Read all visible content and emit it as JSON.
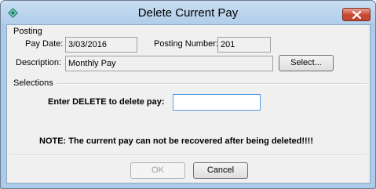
{
  "window": {
    "title": "Delete Current Pay",
    "icon": "app-diamond-icon",
    "close_icon": "close-icon"
  },
  "posting": {
    "group_label": "Posting",
    "pay_date_label": "Pay Date:",
    "pay_date_value": "3/03/2016",
    "posting_number_label": "Posting Number:",
    "posting_number_value": "201",
    "description_label": "Description:",
    "description_value": "Monthly Pay",
    "select_button": "Select..."
  },
  "selections": {
    "group_label": "Selections",
    "prompt_label": "Enter DELETE to delete pay:",
    "confirm_value": "",
    "note": "NOTE: The current pay can not be recovered after being deleted!!!!"
  },
  "buttons": {
    "ok": "OK",
    "cancel": "Cancel"
  },
  "colors": {
    "title_bar": "#afcdea",
    "close_button": "#c9452f",
    "focus_border": "#569de5"
  }
}
